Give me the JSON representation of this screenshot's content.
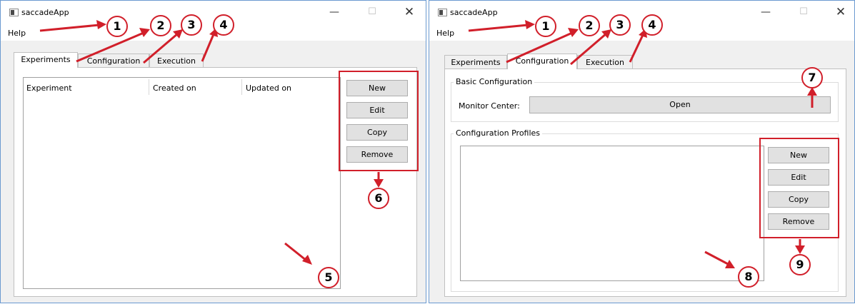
{
  "colors": {
    "annotation": "#d11f2a",
    "window_border": "#6b9ad0"
  },
  "left": {
    "title": "saccadeApp",
    "menu": {
      "help": "Help"
    },
    "tabs": [
      "Experiments",
      "Configuration",
      "Execution"
    ],
    "active_tab": "Experiments",
    "table": {
      "columns": [
        "Experiment",
        "Created on",
        "Updated on"
      ]
    },
    "buttons": {
      "new": "New",
      "edit": "Edit",
      "copy": "Copy",
      "remove": "Remove"
    },
    "callouts": {
      "c1": "1",
      "c2": "2",
      "c3": "3",
      "c4": "4",
      "c5": "5",
      "c6": "6"
    }
  },
  "right": {
    "title": "saccadeApp",
    "menu": {
      "help": "Help"
    },
    "tabs": [
      "Experiments",
      "Configuration",
      "Execution"
    ],
    "active_tab": "Configuration",
    "basic_configuration": {
      "label": "Basic Configuration",
      "monitor_label": "Monitor Center:",
      "open_button": "Open"
    },
    "profiles": {
      "label": "Configuration Profiles"
    },
    "buttons": {
      "new": "New",
      "edit": "Edit",
      "copy": "Copy",
      "remove": "Remove"
    },
    "callouts": {
      "c1": "1",
      "c2": "2",
      "c3": "3",
      "c4": "4",
      "c7": "7",
      "c8": "8",
      "c9": "9"
    }
  }
}
